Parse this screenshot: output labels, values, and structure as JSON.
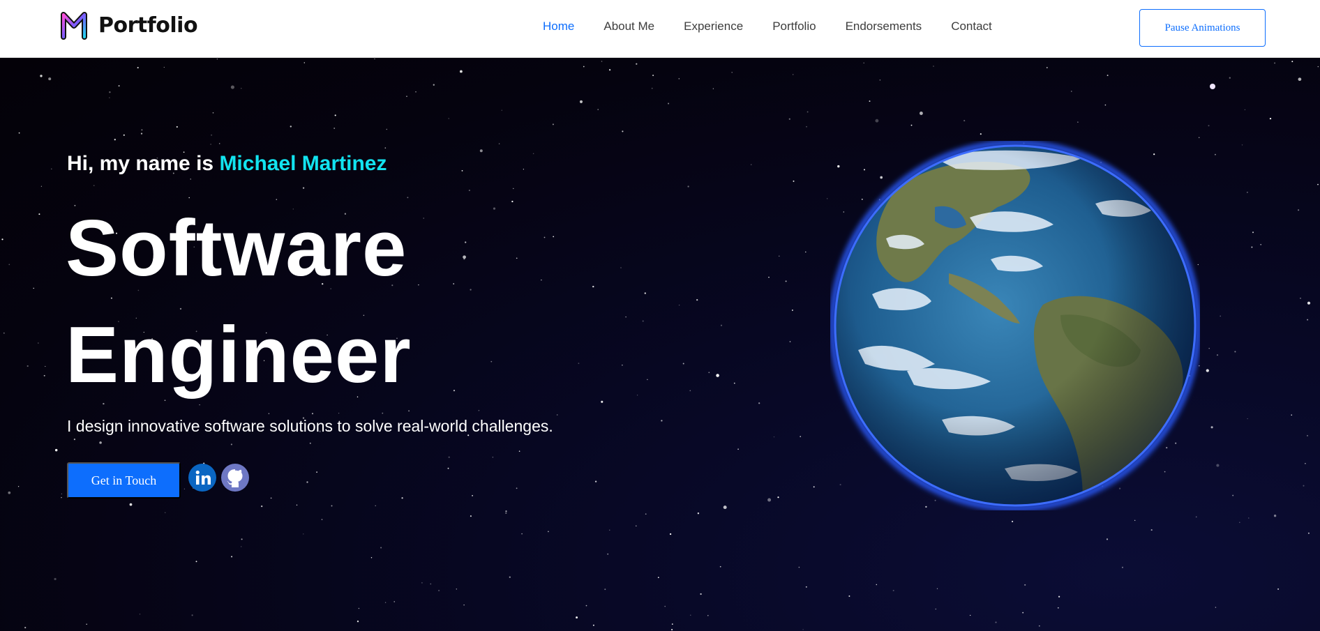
{
  "header": {
    "brand": "Portfolio",
    "nav": [
      "Home",
      "About Me",
      "Experience",
      "Portfolio",
      "Endorsements",
      "Contact"
    ],
    "active_nav": "Home",
    "pause_label": "Pause Animations"
  },
  "hero": {
    "greeting_prefix": "Hi, my name is ",
    "name": "Michael Martinez",
    "title_line1": "Software",
    "title_line2": "Engineer",
    "tagline": "I design innovative software solutions to solve real-world challenges.",
    "cta_label": "Get in Touch",
    "social": [
      "linkedin-icon",
      "github-icon"
    ]
  },
  "colors": {
    "accent": "#0d6efd",
    "name": "#12e3ef",
    "background": "#07030c",
    "linkedin": "#0a66c2",
    "github": "#6e78c4"
  }
}
